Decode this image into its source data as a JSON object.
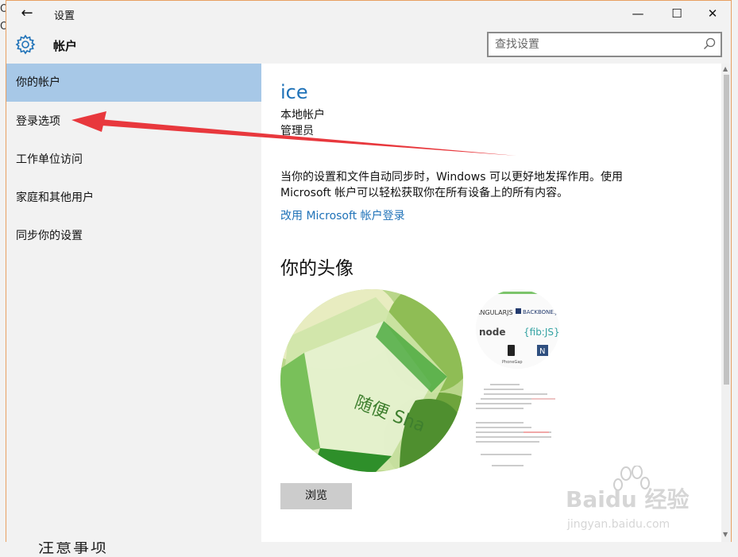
{
  "window": {
    "title": "设置",
    "back_glyph": "←",
    "minimize_glyph": "—",
    "maximize_glyph": "☐",
    "close_glyph": "✕"
  },
  "header": {
    "title": "帐户",
    "search_placeholder": "查找设置"
  },
  "sidebar": {
    "items": [
      {
        "label": "你的帐户",
        "active": true
      },
      {
        "label": "登录选项",
        "active": false
      },
      {
        "label": "工作单位访问",
        "active": false
      },
      {
        "label": "家庭和其他用户",
        "active": false
      },
      {
        "label": "同步你的设置",
        "active": false
      }
    ]
  },
  "account": {
    "name": "ice",
    "type": "本地帐户",
    "role": "管理员",
    "description": "当你的设置和文件自动同步时，Windows 可以更好地发挥作用。使用 Microsoft 帐户可以轻松获取你在所有设备上的所有内容。",
    "switch_link": "改用 Microsoft 帐户登录"
  },
  "avatar": {
    "heading": "你的头像",
    "browse_label": "浏览",
    "main_image_text": "随便 Sha",
    "thumb_a_labels": [
      "ANGULARJS",
      "BACKBONE.JS",
      "node",
      "{fib:JS}",
      "PhoneGap",
      "N"
    ]
  },
  "background": {
    "left_a": "O",
    "left_b": "O",
    "bottom_text": "注意事项"
  },
  "watermark": {
    "brand": "Baidu 经验",
    "url": "jingyan.baidu.com"
  },
  "colors": {
    "accent": "#1f72b8",
    "active_nav": "#a7c8e7",
    "arrow": "#e8383d",
    "window_border": "#e8a062"
  },
  "icons": {
    "gear": "gear-icon",
    "search": "search-icon",
    "back": "back-arrow-icon"
  }
}
